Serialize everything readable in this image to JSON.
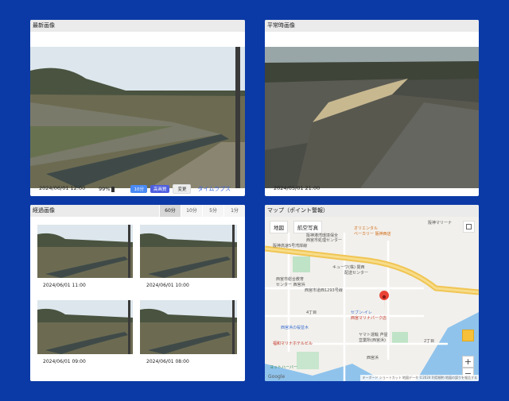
{
  "colors": {
    "background": "#0b3aa6",
    "accent": "#3c63e0",
    "chip_blue": "#4a8af4",
    "chip_indigo": "#4f5fe0"
  },
  "latest": {
    "title": "最新画像",
    "timestamp": "2024/06/01 12:00",
    "battery": "99%",
    "battery_icon": "battery-icon",
    "interval_chip": "10分",
    "quality_chip": "高画質",
    "change_button": "変更",
    "timelapse_link": "タイムラプス"
  },
  "normal": {
    "title": "平常時画像",
    "timestamp": "2024/05/01 21:00"
  },
  "history": {
    "title": "経過画像",
    "tabs": [
      "60分",
      "10分",
      "5分",
      "1分"
    ],
    "active_tab": 0,
    "thumbs": [
      {
        "date": "2024/06/01 11:00"
      },
      {
        "date": "2024/06/01 10:00"
      },
      {
        "date": "2024/06/01 09:00"
      },
      {
        "date": "2024/06/01 08:00"
      }
    ]
  },
  "map": {
    "title": "マップ（ポイント警報）",
    "map_type_map": "地図",
    "map_type_satellite": "航空写真",
    "labels": {
      "oriental": "オリエンタル",
      "bakery": "ベーカリー 阪神西店",
      "hanshin_marina": "阪神マリーナ",
      "expressway": "阪神高速5号湾岸線",
      "factory": "阪神港湾環境保全",
      "center": "西宮市処理センター",
      "kewpie": "キューワ(株) 関西",
      "kewpie2": "配送センター",
      "education": "西宮市総合教育",
      "education2": "センター 西宮浜",
      "road": "西宮市道西1293号線",
      "block4": "4丁目",
      "seven": "セブン-イレ",
      "seven2": "西宮マリナパーク店",
      "sakura": "西宮浜の桜並木",
      "hotel": "福和マリナホテルビル",
      "yamato": "ヤマト運輸 芦屋",
      "yamato2": "営業所(西宮浜)",
      "block2": "2丁目",
      "nishinomiya_hama": "西宮浜",
      "harbor": "ヨットハーバー",
      "google": "Google",
      "footer": "キーボード ショートカット  地図データ ©2024  利用規約  地図の誤りを報告する"
    }
  }
}
